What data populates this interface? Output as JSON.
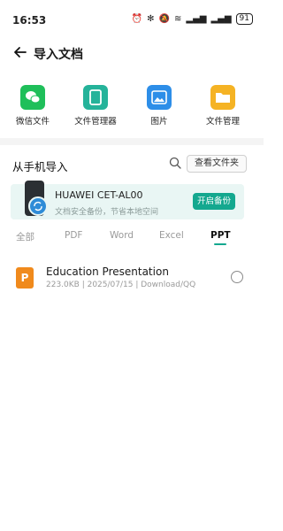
{
  "status": {
    "time": "16:53",
    "battery": "91"
  },
  "header": {
    "title": "导入文档"
  },
  "sources": [
    {
      "label": "微信文件",
      "icon": "wechat-icon",
      "color": "#1fbf5a"
    },
    {
      "label": "文件管理器",
      "icon": "file-manager-icon",
      "color": "#25b39a"
    },
    {
      "label": "图片",
      "icon": "image-icon",
      "color": "#2d8ee8"
    },
    {
      "label": "文件管理",
      "icon": "folder-icon",
      "color": "#f5b324"
    }
  ],
  "section": {
    "title": "从手机导入",
    "view_folder": "查看文件夹"
  },
  "banner": {
    "device": "HUAWEI CET-AL00",
    "subtitle": "文档安全备份，节省本地空间",
    "button": "开启备份"
  },
  "tabs": [
    "全部",
    "PDF",
    "Word",
    "Excel",
    "PPT"
  ],
  "active_tab": "PPT",
  "files": [
    {
      "name": "Education Presentation",
      "meta": "223.0KB | 2025/07/15 | Download/QQ",
      "icon_letter": "P"
    }
  ]
}
